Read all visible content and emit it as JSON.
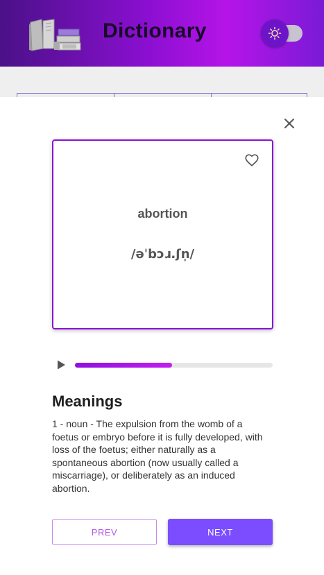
{
  "header": {
    "app_title": "Dictionary",
    "logo_icon": "books-icon",
    "theme_toggle_icon": "sun-icon"
  },
  "card": {
    "word": "abortion",
    "phonetic": "/əˈbɔɹ.ʃn̩/",
    "favorite_icon": "heart-outline-icon"
  },
  "audio": {
    "play_icon": "play-icon",
    "progress_percent": 49
  },
  "meanings": {
    "title": "Meanings",
    "text": "1 - noun - The expulsion from the womb of a foetus or embryo before it is fully developed, with loss of the foetus; either naturally as a spontaneous abortion (now usually called a miscarriage), or deliberately as an induced abortion."
  },
  "nav": {
    "prev_label": "PREV",
    "next_label": "NEXT"
  },
  "modal": {
    "close_icon": "close-icon"
  },
  "colors": {
    "accent": "#8a12d6",
    "next_button": "#7c4dff",
    "prev_border": "#c986f0"
  }
}
